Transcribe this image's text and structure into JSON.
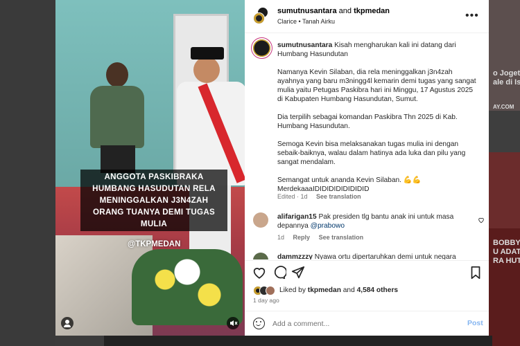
{
  "background": {
    "right_texts": [
      "o Joget",
      "ale di Ist",
      "AY.COM",
      "BOBBY N",
      "U ADAT E",
      "RA HUT R"
    ]
  },
  "media": {
    "caption": "ANGGOTA PASKIBRAKA HUMBANG HASUDUTAN RELA MENINGGALKAN J3N4ZAH ORANG TUANYA DEMI TUGAS MULIA",
    "overlay_handle": "@TKPMEDAN",
    "tag_icon": "user-tag-icon",
    "mute_icon": "mute-icon"
  },
  "header": {
    "user1": "sumutnusantara",
    "and": "and",
    "user2": "tkpmedan",
    "audio": "Clarice",
    "separator": "•",
    "location": "Tanah Airku",
    "more_icon": "more-icon"
  },
  "post": {
    "username": "sumutnusantara",
    "lines": [
      "Kisah mengharukan kali ini datang dari Humbang Hasundutan",
      "Namanya Kevin Silaban, dia rela meninggalkan j3n4zah ayahnya yang baru m3ningg4l kemarin demi tugas yang sangat mulia yaitu Petugas Paskibra hari ini Minggu, 17 Agustus 2025 di Kabupaten Humbang Hasundutan, Sumut.",
      "Dia terpilih sebagai komandan Paskibra Thn 2025 di Kab. Humbang Hasundutan.",
      "Semoga Kevin bisa melaksanakan tugas mulia ini dengan sebaik-baiknya, walau dalam hatinya ada luka dan pilu yang sangat mendalam.",
      "Semangat untuk ananda Kevin Silaban. 💪💪",
      "MerdekaaaIDIDIDIDIDIDIDID"
    ],
    "edited": "Edited · 1d",
    "see_translation": "See translation"
  },
  "comments": [
    {
      "username": "alifarigan15",
      "text": "Pak presiden tlg bantu anak ini untuk masa depannya",
      "mention": "@prabowo",
      "age": "1d",
      "reply": "Reply",
      "see_translation": "See translation"
    },
    {
      "username": "dammzzzy",
      "text": "Nyawa ortu dipertaruhkan demi untuk negara yang",
      "mention": "",
      "age": "",
      "reply": "",
      "see_translation": ""
    }
  ],
  "likes": {
    "liked_by": "Liked by",
    "user": "tkpmedan",
    "and": "and",
    "count": "4,584 others"
  },
  "age": "1 day ago",
  "composer": {
    "placeholder": "Add a comment...",
    "post_label": "Post"
  },
  "colors": {
    "link": "#00376b",
    "post_button": "#85b5f0",
    "meta": "#737373"
  }
}
